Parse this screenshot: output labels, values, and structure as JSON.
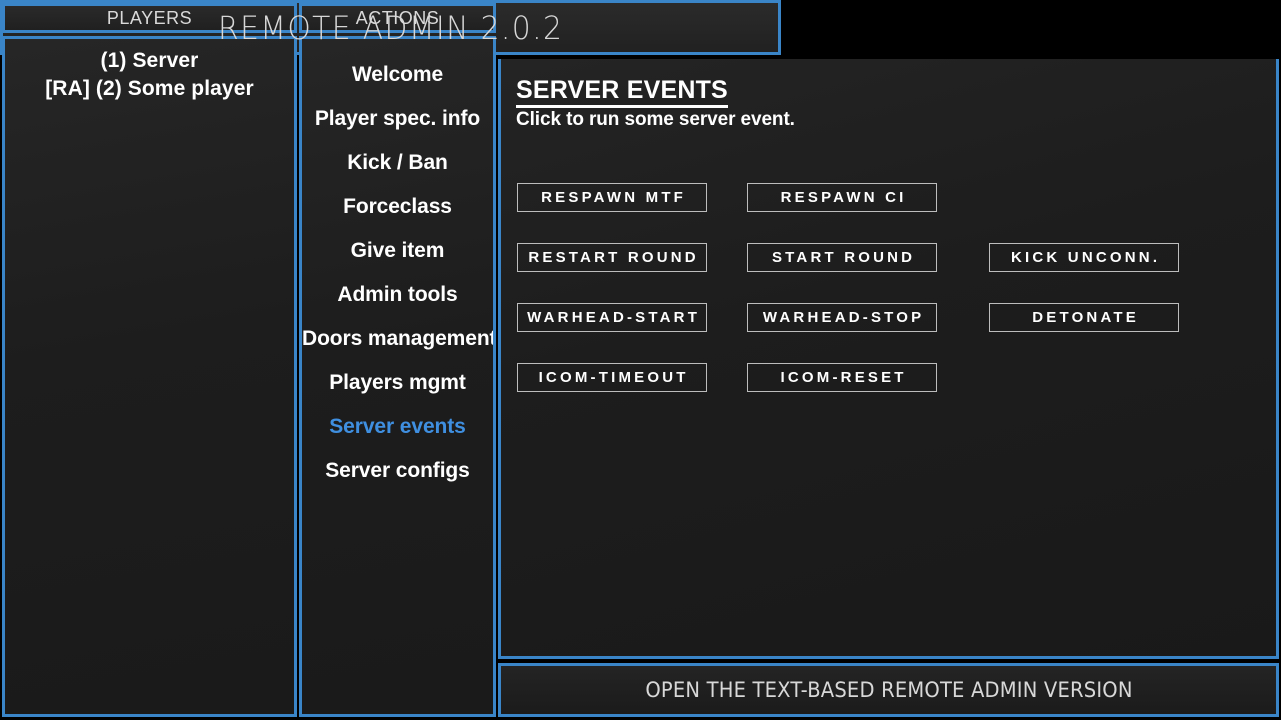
{
  "window": {
    "title": "REMOTE ADMIN 2.0.2",
    "accent_color": "#3a85c8",
    "background_color": "#1c1c1c",
    "active_color": "#3f8fe0"
  },
  "players_panel": {
    "header": "PLAYERS",
    "players": [
      "(1) Server",
      "[RA] (2) Some player"
    ]
  },
  "actions_panel": {
    "header": "ACTIONS",
    "items": [
      {
        "label": "Welcome",
        "active": false
      },
      {
        "label": "Player spec. info",
        "active": false
      },
      {
        "label": "Kick / Ban",
        "active": false
      },
      {
        "label": "Forceclass",
        "active": false
      },
      {
        "label": "Give item",
        "active": false
      },
      {
        "label": "Admin tools",
        "active": false
      },
      {
        "label": "Doors management",
        "active": false
      },
      {
        "label": "Players mgmt",
        "active": false
      },
      {
        "label": "Server events",
        "active": true
      },
      {
        "label": "Server configs",
        "active": false
      }
    ]
  },
  "content": {
    "title": "SERVER EVENTS",
    "subtitle": "Click to run some server event.",
    "buttons": [
      [
        {
          "label": "RESPAWN MTF",
          "col": 0
        },
        {
          "label": "RESPAWN CI",
          "col": 1
        }
      ],
      [
        {
          "label": "RESTART ROUND",
          "col": 0
        },
        {
          "label": "START ROUND",
          "col": 1
        },
        {
          "label": "KICK UNCONN.",
          "col": 2
        }
      ],
      [
        {
          "label": "WARHEAD-START",
          "col": 0
        },
        {
          "label": "WARHEAD-STOP",
          "col": 1
        },
        {
          "label": "DETONATE",
          "col": 2
        }
      ],
      [
        {
          "label": "ICOM-TIMEOUT",
          "col": 0
        },
        {
          "label": "ICOM-RESET",
          "col": 1
        }
      ]
    ]
  },
  "bottom_bar": {
    "label": "OPEN THE TEXT-BASED REMOTE ADMIN VERSION"
  }
}
